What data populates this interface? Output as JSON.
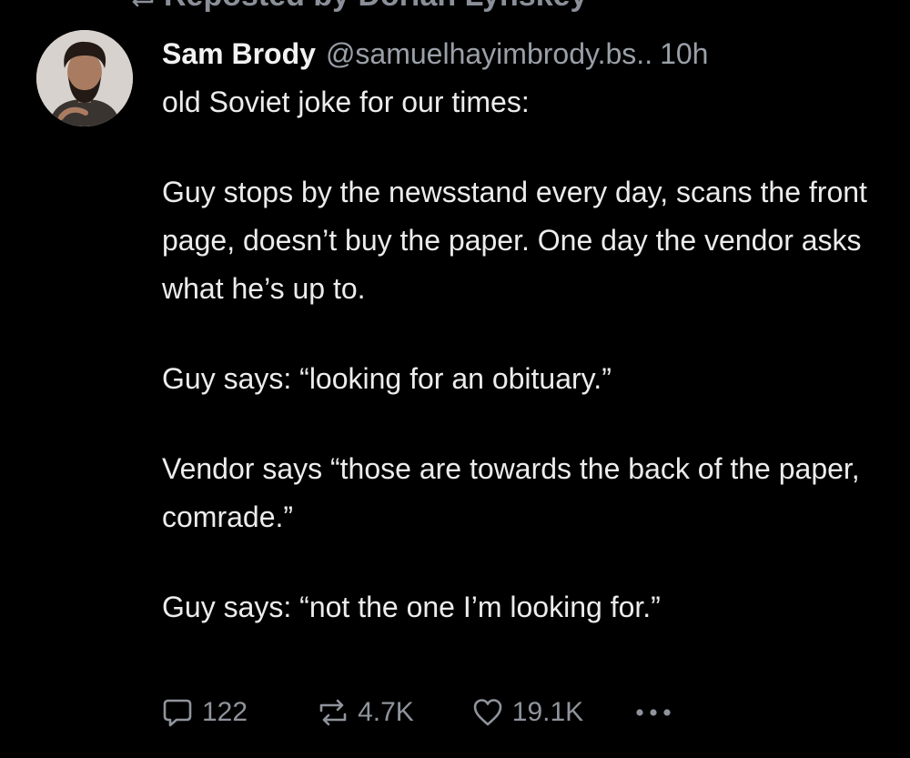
{
  "repost": {
    "text": "Reposted by Dorian Lynskey",
    "icon": "repost-icon"
  },
  "post": {
    "author_name": "Sam Brody",
    "handle": "@samuelhayimbrody.bs..",
    "time": "10h",
    "paragraphs": [
      "old Soviet joke for our times:",
      "Guy stops by the newsstand every day, scans the front page, doesn’t buy the paper. One day the vendor asks what he’s up to.",
      "Guy says: “looking for an obituary.”",
      "Vendor says “those are towards the back of the paper, comrade.”",
      "Guy says: “not the one I’m looking for.”"
    ]
  },
  "actions": {
    "replies": "122",
    "reposts": "4.7K",
    "likes": "19.1K",
    "icons": [
      "reply-icon",
      "repost-icon",
      "heart-icon",
      "more-icon"
    ]
  },
  "colors": {
    "background": "#000000",
    "text": "#ececec",
    "muted": "#9aa0a8"
  }
}
